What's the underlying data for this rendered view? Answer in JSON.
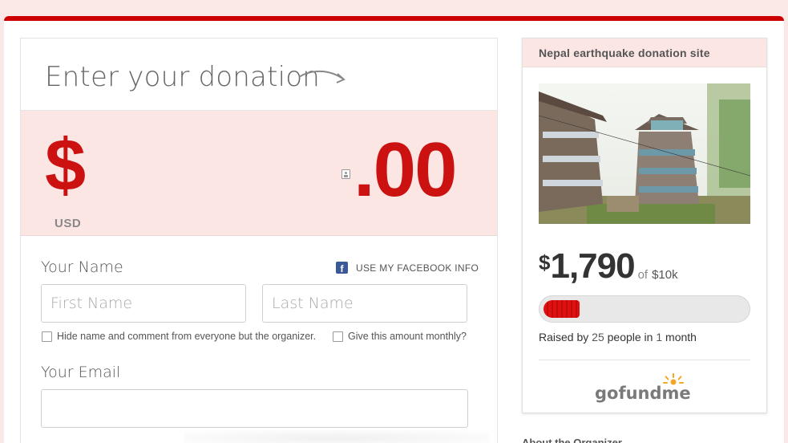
{
  "donation": {
    "title": "Enter your donation",
    "currency_symbol": "$",
    "currency_code": "USD",
    "amount_cents": ".00",
    "name_label": "Your Name",
    "facebook_label": "USE MY FACEBOOK INFO",
    "first_name_placeholder": "First Name",
    "last_name_placeholder": "Last Name",
    "hide_name_label": "Hide name and comment from everyone but the organizer.",
    "monthly_label": "Give this amount monthly?",
    "email_label": "Your Email",
    "email_value": ""
  },
  "campaign": {
    "title": "Nepal earthquake donation site",
    "raised_symbol": "$",
    "raised_amount": "1,790",
    "of_text": "of",
    "goal": "$10k",
    "progress_fraction": 0.179,
    "raised_by_prefix": "Raised by",
    "people_count": "25",
    "people_suffix": "people in",
    "duration_count": "1",
    "duration_unit": "month",
    "about_label": "About the Organizer"
  },
  "logo": {
    "text": "gofundme"
  },
  "colors": {
    "accent": "#cc1111",
    "panel_tint": "#fce6e4",
    "facebook": "#3b5998"
  },
  "icons": {
    "arrow": "curved-arrow-icon",
    "contact": "contact-card-icon",
    "facebook": "facebook-icon"
  }
}
